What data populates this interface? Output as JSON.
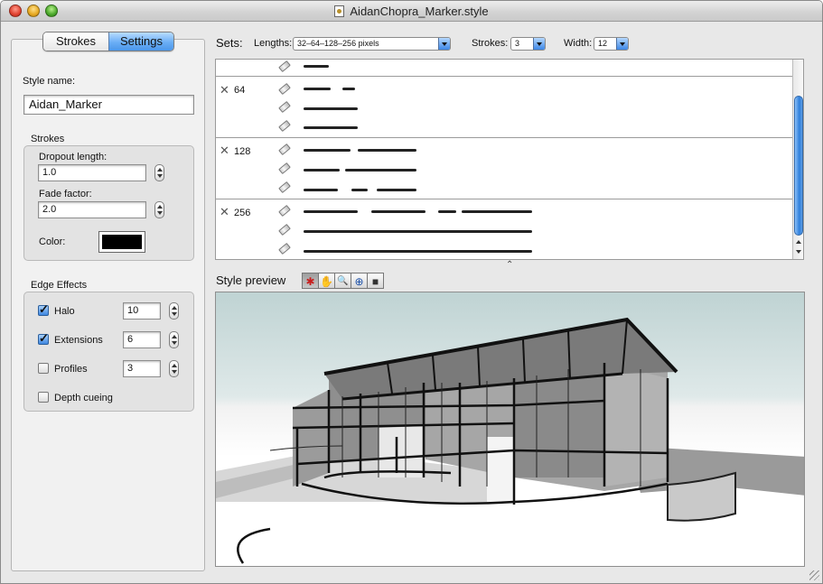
{
  "window": {
    "title": "AidanChopra_Marker.style"
  },
  "tabs": [
    {
      "label": "Strokes",
      "selected": false
    },
    {
      "label": "Settings",
      "selected": true
    }
  ],
  "settings": {
    "style_name_label": "Style name:",
    "style_name_value": "Aidan_Marker",
    "strokes_group": {
      "title": "Strokes",
      "dropout_label": "Dropout length:",
      "dropout_value": "1.0",
      "fade_label": "Fade factor:",
      "fade_value": "2.0",
      "color_label": "Color:",
      "color_value": "#000000"
    },
    "edge_group": {
      "title": "Edge Effects",
      "halo": {
        "label": "Halo",
        "checked": true,
        "value": "10"
      },
      "extensions": {
        "label": "Extensions",
        "checked": true,
        "value": "6"
      },
      "profiles": {
        "label": "Profiles",
        "checked": false,
        "value": "3"
      },
      "depth": {
        "label": "Depth cueing",
        "checked": false
      }
    }
  },
  "sets": {
    "label": "Sets:",
    "lengths_label": "Lengths:",
    "lengths_value": "32–64–128–256 pixels",
    "strokes_label": "Strokes:",
    "strokes_value": "3",
    "width_label": "Width:",
    "width_value": "12",
    "groups": [
      {
        "size": "64"
      },
      {
        "size": "128"
      },
      {
        "size": "256"
      }
    ]
  },
  "preview": {
    "title": "Style preview",
    "tools": [
      "orbit-icon",
      "pan-icon",
      "zoom-icon",
      "zoom-extents-icon",
      "camera-icon"
    ]
  },
  "colors": {
    "selected_tab": "#4b96ea",
    "scroll_thumb": "#2f7fdc",
    "sky": "#bfd3d3"
  }
}
